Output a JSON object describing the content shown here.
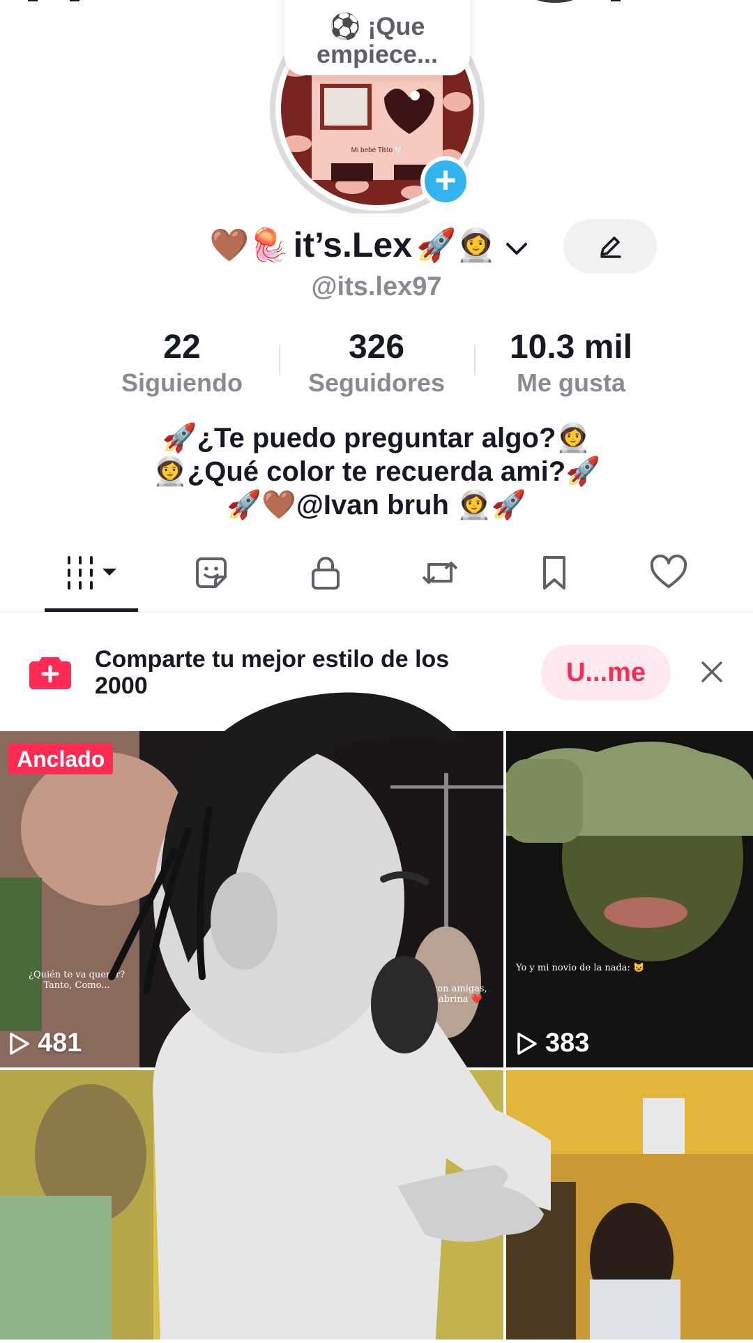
{
  "note": {
    "text": "⚽ ¡Que empiece..."
  },
  "avatar": {
    "caption": "Mi bebé Titito 🤍"
  },
  "profile": {
    "emoji_prefix": "🤎🪼",
    "name": "it’s.Lex",
    "emoji_suffix": "🚀👩‍🚀",
    "handle": "@its.lex97"
  },
  "stats": [
    {
      "value": "22",
      "label": "Siguiendo"
    },
    {
      "value": "326",
      "label": "Seguidores"
    },
    {
      "value": "10.3 mil",
      "label": "Me gusta"
    }
  ],
  "bio": {
    "line1": "🚀¿Te puedo preguntar algo?👩‍🚀",
    "line2": "👩‍🚀¿Qué color te recuerda ami?🚀",
    "line3": "🚀🤎@Ivan bruh 👩‍🚀🚀"
  },
  "tabs": [
    {
      "icon": "grid-icon"
    },
    {
      "icon": "sticker-icon"
    },
    {
      "icon": "lock-icon"
    },
    {
      "icon": "repost-icon"
    },
    {
      "icon": "bookmark-icon"
    },
    {
      "icon": "heart-icon"
    }
  ],
  "promo": {
    "text": "Comparte tu mejor estilo de los 2000",
    "button": "U...me"
  },
  "videos": [
    {
      "badge": "Anclado",
      "views": "481",
      "caption": "¿Quién te va querer? Tanto, Como...",
      "caption2": "con amigas, Sabrina ❤️"
    },
    {
      "views": "383",
      "caption": "Yo y mi novio de la nada: 😺"
    }
  ],
  "colors": {
    "accent": "#fe2c55",
    "plus": "#33b4f0",
    "text": "#161823",
    "muted": "#8a8b91"
  }
}
